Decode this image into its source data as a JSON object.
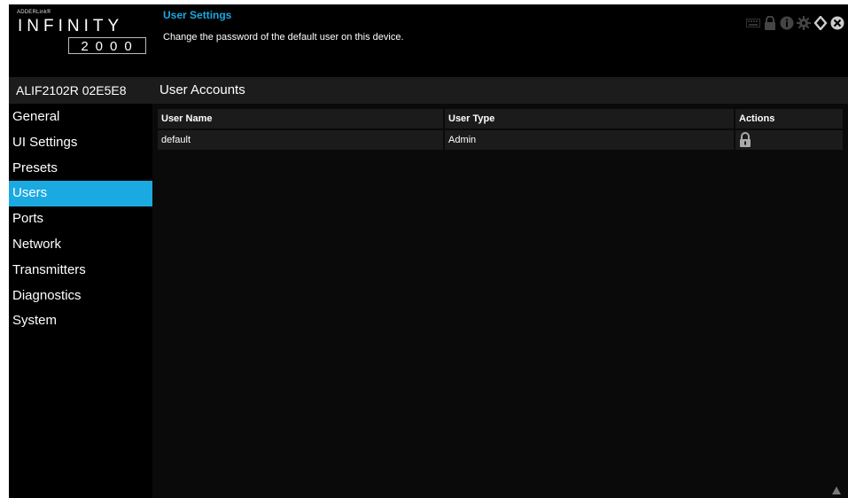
{
  "logo": {
    "brand_small": "ADDERLink®",
    "wordmark": "INFINITY",
    "model": "2000"
  },
  "header": {
    "title": "User Settings",
    "subtitle": "Change the password of the default user on this device."
  },
  "top_icons": [
    "keyboard-icon",
    "lock-icon",
    "info-icon",
    "gear-icon",
    "refresh-icon",
    "close-icon"
  ],
  "sidebar": {
    "device_name": "ALIF2102R 02E5E8",
    "items": [
      {
        "label": "General",
        "active": false
      },
      {
        "label": "UI Settings",
        "active": false
      },
      {
        "label": "Presets",
        "active": false
      },
      {
        "label": "Users",
        "active": true
      },
      {
        "label": "Ports",
        "active": false
      },
      {
        "label": "Network",
        "active": false
      },
      {
        "label": "Transmitters",
        "active": false
      },
      {
        "label": "Diagnostics",
        "active": false
      },
      {
        "label": "System",
        "active": false
      }
    ]
  },
  "main": {
    "section_title": "User Accounts",
    "table": {
      "headers": [
        "User Name",
        "User Type",
        "Actions"
      ],
      "rows": [
        {
          "user_name": "default",
          "user_type": "Admin",
          "action_icon": "lock-icon"
        }
      ]
    }
  },
  "colors": {
    "accent": "#1ba9e1",
    "background": "#000000",
    "panel": "#1c1c1c"
  }
}
